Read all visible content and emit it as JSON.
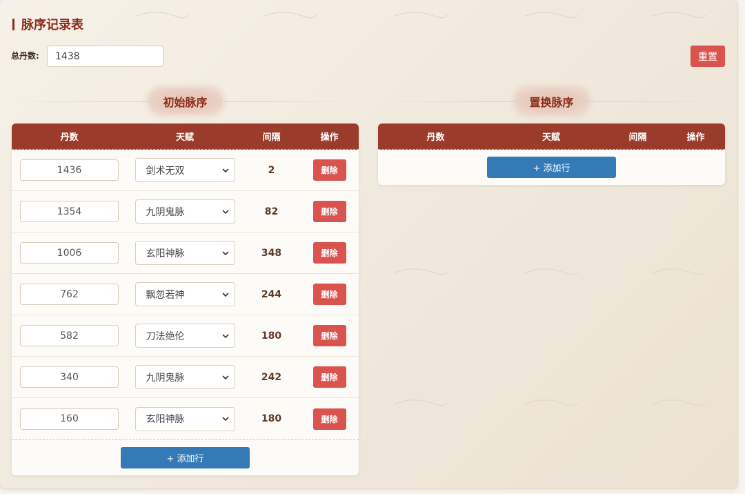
{
  "page": {
    "title": "脉序记录表"
  },
  "total": {
    "label": "总丹数:",
    "value": "1438"
  },
  "toolbar": {
    "reset_label": "重置"
  },
  "initial": {
    "heading": "初始脉序",
    "columns": {
      "dan": "丹数",
      "talent": "天赋",
      "interval": "间隔",
      "action": "操作"
    },
    "rows": [
      {
        "dan": "1436",
        "talent": "剑术无双",
        "interval": "2"
      },
      {
        "dan": "1354",
        "talent": "九阴鬼脉",
        "interval": "82"
      },
      {
        "dan": "1006",
        "talent": "玄阳神脉",
        "interval": "348"
      },
      {
        "dan": "762",
        "talent": "飘忽若神",
        "interval": "244"
      },
      {
        "dan": "582",
        "talent": "刀法绝伦",
        "interval": "180"
      },
      {
        "dan": "340",
        "talent": "九阴鬼脉",
        "interval": "242"
      },
      {
        "dan": "160",
        "talent": "玄阳神脉",
        "interval": "180"
      }
    ],
    "delete_label": "删除",
    "add_label": "+ 添加行"
  },
  "replacement": {
    "heading": "置换脉序",
    "columns": {
      "dan": "丹数",
      "talent": "天赋",
      "interval": "间隔",
      "action": "操作"
    },
    "rows": [],
    "add_label": "+ 添加行"
  },
  "icons": {
    "talent_select": "chevron-down-icon",
    "title_marker": "title-bar-icon"
  },
  "colors": {
    "header": "#9a3b2c",
    "accent_text": "#8b2a1a",
    "danger": "#d9534f",
    "primary": "#337ab7",
    "background": "#f3eee5"
  }
}
